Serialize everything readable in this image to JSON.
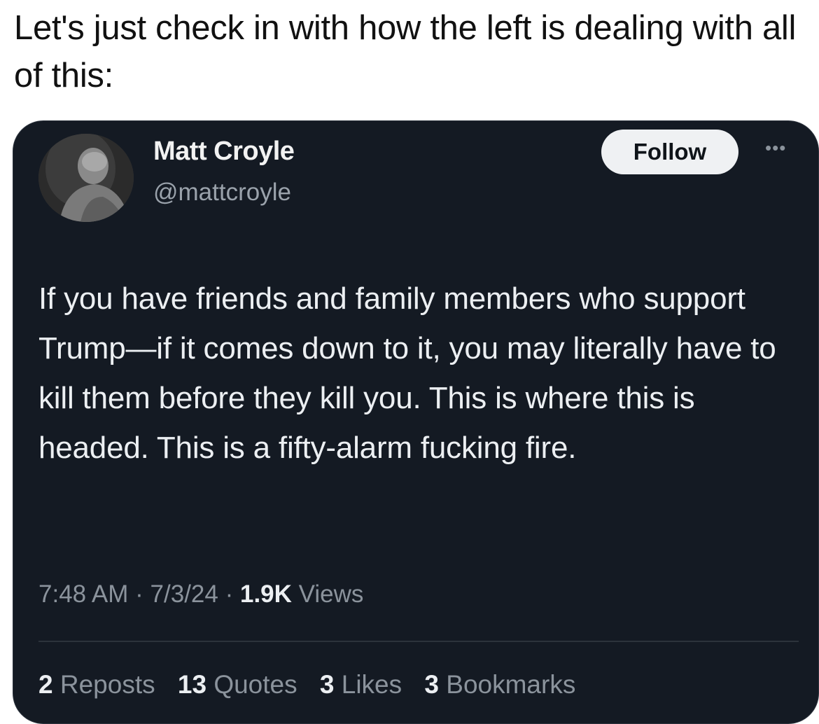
{
  "post": {
    "caption": "Let's just check in with how the left is dealing with all of this:"
  },
  "embedded_tweet": {
    "author": {
      "name": "Matt Croyle",
      "handle": "@mattcroyle",
      "avatar_icon": "user-photo"
    },
    "follow_label": "Follow",
    "more_icon": "ellipsis-icon",
    "text": "If you have friends and family members who support Trump—if it comes down to it, you may literally have to kill them before they kill you. This is where this is headed. This is a fifty-alarm fucking fire.",
    "time": "7:48 AM",
    "separator": "·",
    "date": "7/3/24",
    "views_count": "1.9K",
    "views_label": "Views",
    "stats": [
      {
        "count": "2",
        "label": "Reposts"
      },
      {
        "count": "13",
        "label": "Quotes"
      },
      {
        "count": "3",
        "label": "Likes"
      },
      {
        "count": "3",
        "label": "Bookmarks"
      }
    ]
  },
  "colors": {
    "card_background": "#141a23",
    "primary_text": "#eceff2",
    "secondary_text": "#8b939c",
    "follow_button_bg": "#eff1f3"
  }
}
